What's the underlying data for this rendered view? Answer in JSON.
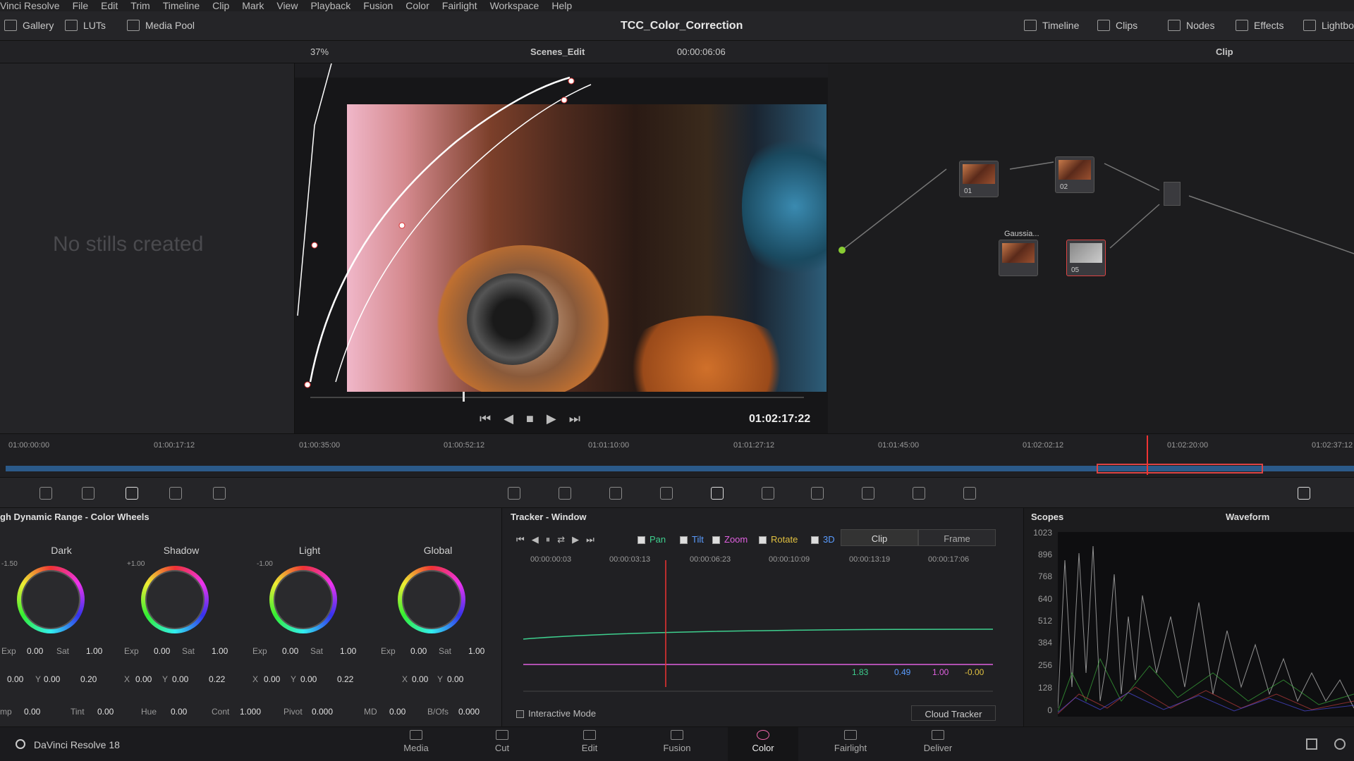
{
  "menu": [
    "Vinci Resolve",
    "File",
    "Edit",
    "Trim",
    "Timeline",
    "Clip",
    "Mark",
    "View",
    "Playback",
    "Fusion",
    "Color",
    "Fairlight",
    "Workspace",
    "Help"
  ],
  "topbar": {
    "gallery": "Gallery",
    "luts": "LUTs",
    "media_pool": "Media Pool",
    "project_title": "TCC_Color_Correction",
    "timeline": "Timeline",
    "clips": "Clips",
    "nodes": "Nodes",
    "effects": "Effects",
    "lightbox": "Lightbo"
  },
  "viewer_bar": {
    "zoom": "37%",
    "timeline_name": "Scenes_Edit",
    "timecode": "00:00:06:06",
    "mode": "Clip"
  },
  "gallery": {
    "empty_text": "No stills created"
  },
  "viewer": {
    "timecode": "01:02:17:22"
  },
  "timeline_ticks": [
    "01:00:00:00",
    "01:00:17:12",
    "01:00:35:00",
    "01:00:52:12",
    "01:01:10:00",
    "01:01:27:12",
    "01:01:45:00",
    "01:02:02:12",
    "01:02:20:00",
    "01:02:37:12"
  ],
  "nodes": [
    {
      "label": "01"
    },
    {
      "label": "02"
    },
    {
      "label": "Gaussia..."
    },
    {
      "label": "05"
    }
  ],
  "color_wheels": {
    "title": "gh Dynamic Range - Color Wheels",
    "wheels": [
      {
        "name": "Dark",
        "range": "-1.50",
        "exp": "0.00",
        "sat": "1.00",
        "x": "0.00",
        "y": "0.00",
        "z": "0.20"
      },
      {
        "name": "Shadow",
        "range": "+1.00",
        "exp": "0.00",
        "sat": "1.00",
        "x": "0.00",
        "y": "0.00",
        "z": "0.22"
      },
      {
        "name": "Light",
        "range": "-1.00",
        "exp": "0.00",
        "sat": "1.00",
        "x": "0.00",
        "y": "0.00",
        "z": "0.22"
      },
      {
        "name": "Global",
        "range": "",
        "exp": "0.00",
        "sat": "1.00",
        "x": "0.00",
        "y": "0.00",
        "z": ""
      }
    ],
    "labels": {
      "exp": "Exp",
      "sat": "Sat",
      "x": "X",
      "y": "Y"
    },
    "bottom": {
      "temp_label": "mp",
      "temp": "0.00",
      "tint_label": "Tint",
      "tint": "0.00",
      "hue_label": "Hue",
      "hue": "0.00",
      "cont_label": "Cont",
      "cont": "1.000",
      "pivot_label": "Pivot",
      "pivot": "0.000",
      "md_label": "MD",
      "md": "0.00",
      "bofs_label": "B/Ofs",
      "bofs": "0.000"
    }
  },
  "tracker": {
    "title": "Tracker - Window",
    "pan": "Pan",
    "tilt": "Tilt",
    "zoom": "Zoom",
    "rotate": "Rotate",
    "three_d": "3D",
    "clip": "Clip",
    "frame": "Frame",
    "ticks": [
      "00:00:00:03",
      "00:00:03:13",
      "00:00:06:23",
      "00:00:10:09",
      "00:00:13:19",
      "00:00:17:06"
    ],
    "values": {
      "pan": "1.83",
      "tilt": "0.49",
      "zoom": "1.00",
      "rotate": "-0.00"
    },
    "interactive": "Interactive Mode",
    "cloud": "Cloud Tracker",
    "colors": {
      "pan": "#3ecf8e",
      "tilt": "#5a9cff",
      "zoom": "#e060e0",
      "rotate": "#e0c040"
    }
  },
  "scopes": {
    "title": "Scopes",
    "type": "Waveform",
    "y_labels": [
      "1023",
      "896",
      "768",
      "640",
      "512",
      "384",
      "256",
      "128",
      "0"
    ]
  },
  "bottombar": {
    "app": "DaVinci Resolve 18",
    "pages": [
      {
        "label": "Media"
      },
      {
        "label": "Cut"
      },
      {
        "label": "Edit"
      },
      {
        "label": "Fusion"
      },
      {
        "label": "Color"
      },
      {
        "label": "Fairlight"
      },
      {
        "label": "Deliver"
      }
    ],
    "active": "Color"
  }
}
